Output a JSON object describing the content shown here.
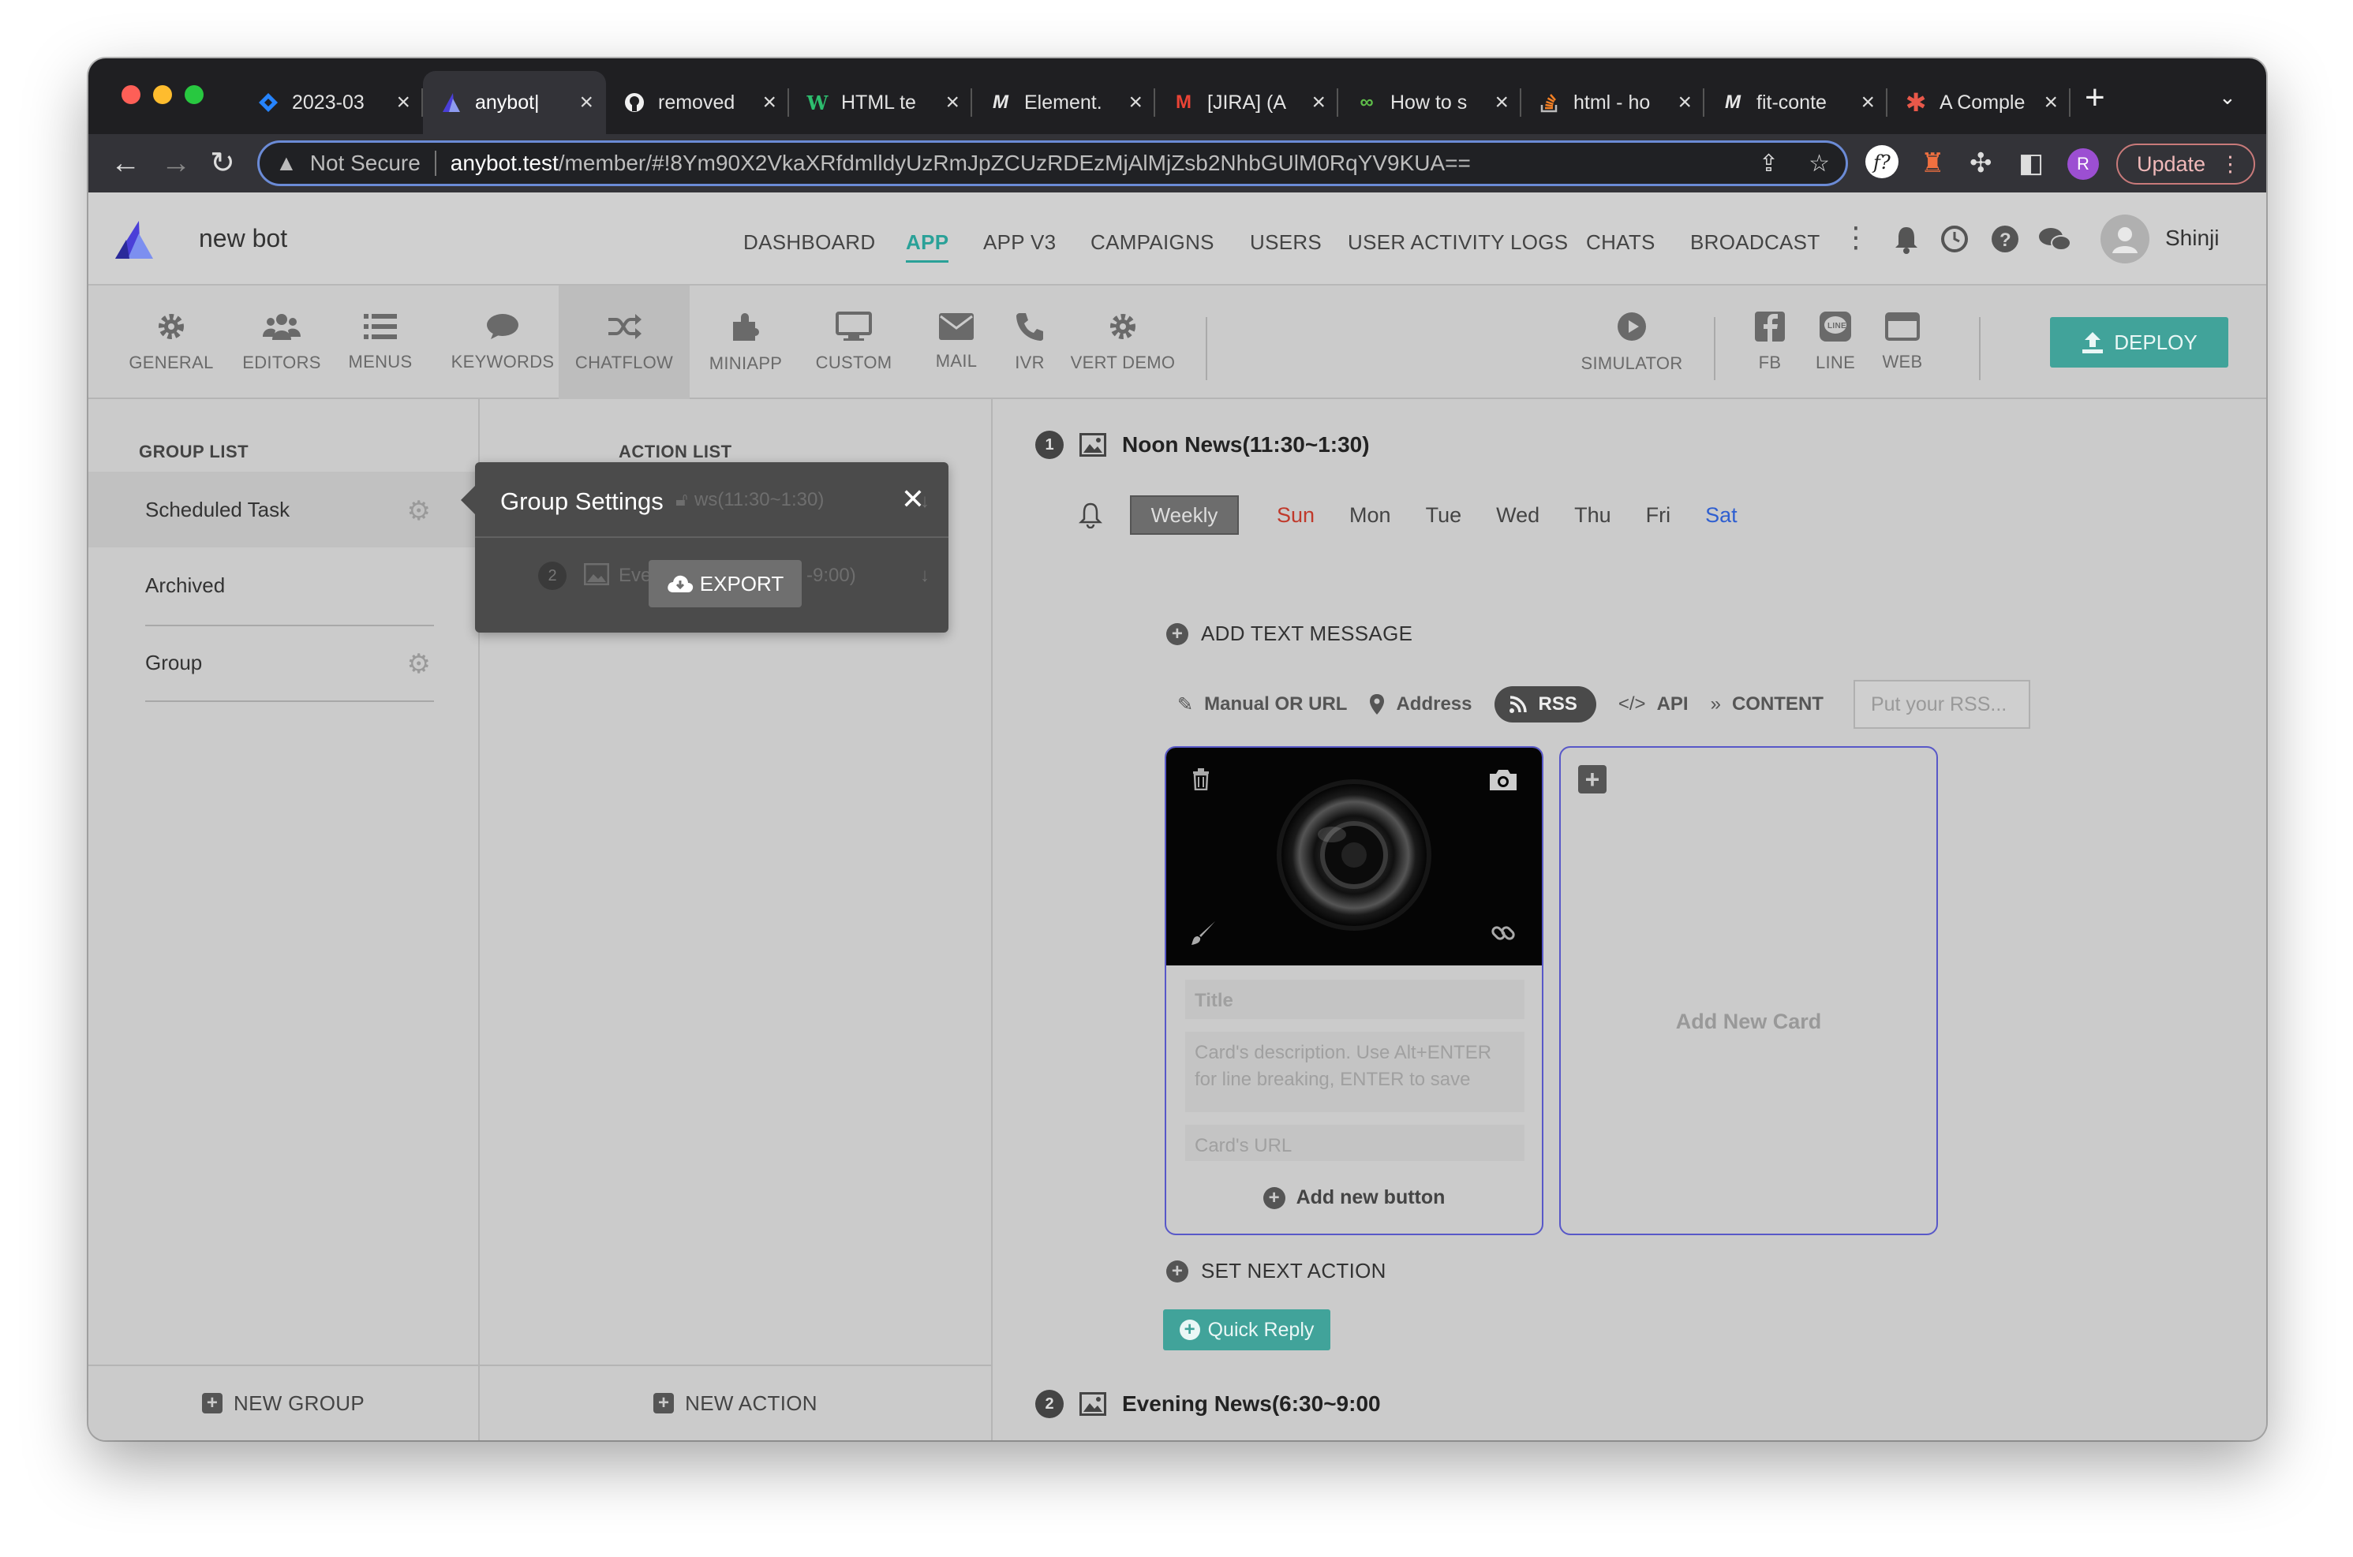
{
  "browser": {
    "tabs": [
      {
        "title": "2023-03",
        "favicon": "jira-diamond-icon",
        "active": false
      },
      {
        "title": "anybot|",
        "favicon": "anybot-logo-icon",
        "active": true
      },
      {
        "title": "removed",
        "favicon": "github-icon",
        "active": false
      },
      {
        "title": "HTML te",
        "favicon": "w3-icon",
        "active": false
      },
      {
        "title": "Element.",
        "favicon": "mdn-icon",
        "active": false
      },
      {
        "title": "[JIRA] (A",
        "favicon": "gmail-icon",
        "active": false
      },
      {
        "title": "How to s",
        "favicon": "link-icon",
        "active": false
      },
      {
        "title": "html - ho",
        "favicon": "stackoverflow-icon",
        "active": false
      },
      {
        "title": "fit-conte",
        "favicon": "mdn-icon",
        "active": false
      },
      {
        "title": "A Comple",
        "favicon": "asterisk-icon",
        "active": false
      }
    ],
    "address": {
      "security": "Not Secure",
      "host": "anybot.test",
      "path": "/member/#!8Ym90X2VkaXRfdmlldyUzRmJpZCUzRDEzMjAlMjZsb2NhbGUlM0RqYV9KUA=="
    },
    "profile_initial": "R",
    "update_label": "Update"
  },
  "app": {
    "bot_name": "new bot",
    "menu": [
      "DASHBOARD",
      "APP",
      "APP V3",
      "CAMPAIGNS",
      "USERS",
      "USER ACTIVITY LOGS",
      "CHATS",
      "BROADCAST"
    ],
    "active_menu": "APP",
    "user_name": "Shinji",
    "toolbar": {
      "general": "GENERAL",
      "editors": "EDITORS",
      "menus": "MENUS",
      "keywords": "KEYWORDS",
      "chatflow": "CHATFLOW",
      "miniapp": "MINIAPP",
      "custom": "CUSTOM",
      "mail": "MAIL",
      "ivr": "IVR",
      "vert_demo": "VERT DEMO",
      "simulator": "SIMULATOR",
      "fb": "FB",
      "line": "LINE",
      "web": "WEB",
      "deploy": "DEPLOY"
    },
    "group_list": {
      "title": "GROUP LIST",
      "items": [
        "Scheduled Task",
        "Archived",
        "Group"
      ],
      "new_group": "NEW GROUP"
    },
    "action_list": {
      "title": "ACTION LIST",
      "ghost_row1": "ws(11:30~1:30)",
      "ghost_row2_left": "Eve",
      "ghost_row2_right": "-9:00)",
      "row2_num": "2",
      "new_action": "NEW ACTION"
    },
    "popup": {
      "title": "Group Settings",
      "export": "EXPORT"
    },
    "schedule": {
      "num": "1",
      "title": "Noon News(11:30~1:30)",
      "weekly": "Weekly",
      "days": [
        "Sun",
        "Mon",
        "Tue",
        "Wed",
        "Thu",
        "Fri",
        "Sat"
      ],
      "add_text": "ADD TEXT MESSAGE",
      "sources": {
        "manual": "Manual OR URL",
        "address": "Address",
        "rss": "RSS",
        "api": "API",
        "content": "CONTENT"
      },
      "rss_placeholder": "Put your RSS...",
      "card": {
        "title_placeholder": "Title",
        "desc_placeholder": "Card's description. Use Alt+ENTER for line breaking, ENTER to save",
        "url_placeholder": "Card's URL",
        "add_button": "Add new button"
      },
      "add_card": "Add New Card",
      "set_next": "SET NEXT ACTION",
      "quick_reply": "Quick Reply",
      "next_num": "2",
      "next_title": "Evening News(6:30~9:00"
    },
    "colors": {
      "accent": "#2aa198",
      "deploy_bg": "#41a39a",
      "sun": "#c0392b",
      "sat": "#2f5fd0",
      "card_border": "#5858c8"
    }
  }
}
